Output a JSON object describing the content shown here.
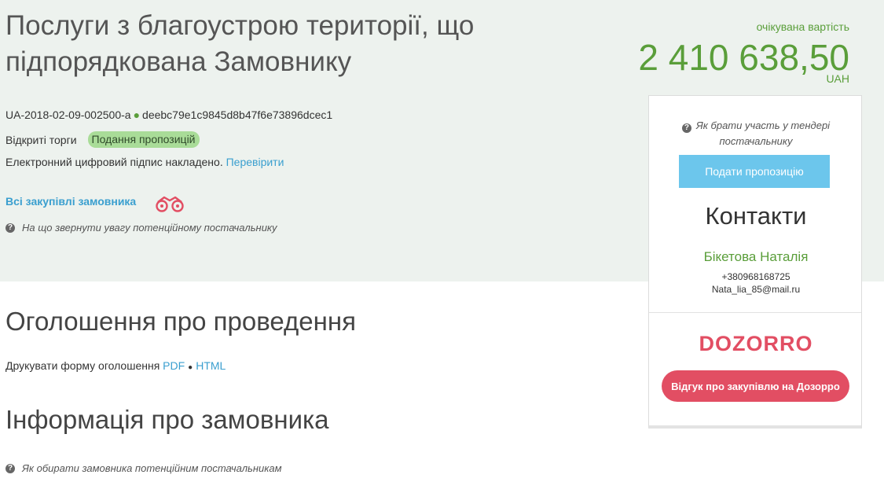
{
  "tender": {
    "title": "Послуги з благоустрою території, що підпорядкована Замовнику",
    "id": "UA-2018-02-09-002500-a",
    "hash": "deebc79e1c9845d8b47f6e73896dcec1",
    "procedure_type": "Відкриті торги",
    "status_badge": "Подання пропозицій",
    "signature_text": "Електронний цифровий підпис накладено.",
    "signature_link": "Перевірити",
    "all_purchases_link": "Всі закупівлі замовника",
    "supplier_hint": "На що звернути увагу потенційному постачальнику"
  },
  "price": {
    "label": "очікувана вартість",
    "value": "2 410 638,50",
    "currency": "UAH"
  },
  "sidebar": {
    "participate_hint": "Як брати участь у тендері постачальнику",
    "submit_button": "Подати пропозицію",
    "contacts_title": "Контакти",
    "contact_name": "Бікетова Наталія",
    "contact_phone": "+380968168725",
    "contact_email": "Nata_lia_85@mail.ru",
    "dozorro_logo": "DOZORRO",
    "dozorro_button": "Відгук про закупівлю на Дозорро"
  },
  "announcement": {
    "heading": "Оголошення про проведення",
    "print_label": "Друкувати форму оголошення",
    "pdf_link": "PDF",
    "html_link": "HTML"
  },
  "customer_info": {
    "heading": "Інформація про замовника",
    "hint": "Як обирати замовника потенційним постачальникам"
  },
  "colors": {
    "green": "#5a9e3a",
    "link_blue": "#3a9fcf",
    "badge_green": "#a9dc98",
    "offer_button": "#6cc6ec",
    "dozorro_red": "#e24e63",
    "top_band": "#edf2ee"
  },
  "icons": [
    "question-circle-icon",
    "binoculars-icon",
    "dot-separator-icon"
  ]
}
